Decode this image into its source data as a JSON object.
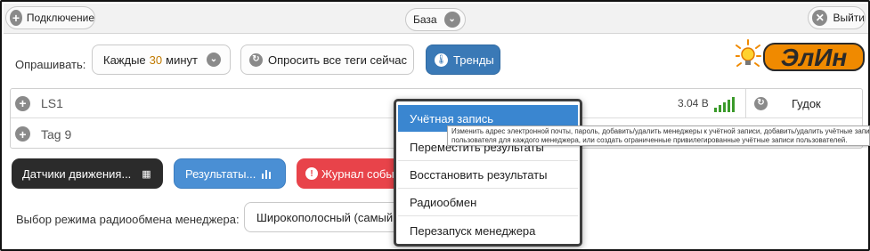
{
  "topbar": {
    "connect_label": "Подключение",
    "base_label": "База",
    "exit_label": "Выйти"
  },
  "polling": {
    "label": "Опрашивать:",
    "interval_prefix": "Каждые",
    "interval_value": "30",
    "interval_unit": "минут",
    "poll_all_label": "Опросить все теги сейчас",
    "trends_label": "Тренды"
  },
  "logo_text": "ЭлИн",
  "tags": [
    {
      "name": "LS1",
      "voltage": "3.04 В",
      "signal_bars": 5
    },
    {
      "name": "Tag 9"
    }
  ],
  "beep_label": "Гудок",
  "buttons": {
    "motion_sensors": "Датчики движения...",
    "results": "Результаты...",
    "event_log": "Журнал собы"
  },
  "radio_mode": {
    "label": "Выбор режима радиообмена менеджера:",
    "value": "Широкополосный (самый"
  },
  "dropdown_menu": {
    "items": [
      "Учётная запись",
      "Переместить результаты",
      "Восстановить результаты",
      "Радиообмен",
      "Перезапуск менеджера"
    ],
    "active_index": 0
  },
  "tooltip": {
    "line1": "Изменить адрес электронной почты, пароль, добавить/удалить менеджеры к учётной записи, добавить/удалить учётные записи",
    "line2": "пользователя для каждого менеджера, или создать ограниченные привилегированные учётные записи пользователей."
  },
  "colors": {
    "accent_blue": "#3a86d0",
    "trend_blue": "#3a79b6",
    "dark_button": "#2b2b2b",
    "results_button": "#4a8fd4",
    "log_button": "#e8434a",
    "signal_green": "#3a9a2a",
    "logo_orange": "#f08a00"
  }
}
